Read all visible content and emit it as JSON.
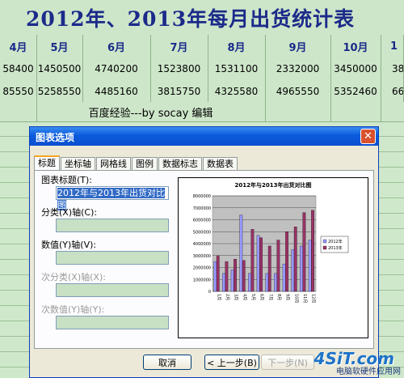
{
  "sheet": {
    "title": "2012年、2013年每月出货统计表",
    "months": [
      "4月",
      "5月",
      "6月",
      "7月",
      "8月",
      "9月",
      "10月",
      "1"
    ],
    "row_2012": [
      "58400",
      "1450500",
      "4740200",
      "1523800",
      "1531100",
      "2332000",
      "3450000",
      "38"
    ],
    "row_2013": [
      "85550",
      "5258550",
      "4485160",
      "3815750",
      "4325580",
      "4965550",
      "5352460",
      "66"
    ],
    "note": "百度经验---by socay 编辑"
  },
  "dialog": {
    "title": "图表选项",
    "close_label": "✕",
    "tabs": [
      "标题",
      "坐标轴",
      "网格线",
      "图例",
      "数据标志",
      "数据表"
    ],
    "active_tab": "标题",
    "fields": {
      "chart_title_label": "图表标题(T):",
      "chart_title_value": "2012年与2013年出货对比图",
      "category_x_label": "分类(X)轴(C):",
      "value_y_label": "数值(Y)轴(V):",
      "secondary_category_label": "次分类(X)轴(X):",
      "secondary_value_label": "次数值(Y)轴(Y):"
    },
    "buttons": {
      "cancel": "取消",
      "back": "< 上一步(B)",
      "next": "下一步(N)"
    }
  },
  "chart_data": {
    "type": "bar",
    "title": "2012年与2013年出货对比图",
    "categories": [
      "1月",
      "2月",
      "3月",
      "4月",
      "5月",
      "6月",
      "7月",
      "8月",
      "9月",
      "10月",
      "11月",
      "12月"
    ],
    "ylim": [
      0,
      8000000
    ],
    "yticks": [
      "8000000",
      "7000000",
      "6000000",
      "5000000",
      "4000000",
      "3000000",
      "2000000",
      "1000000",
      "0"
    ],
    "legend_position": "right",
    "series": [
      {
        "name": "2012年",
        "color": "#9999ff",
        "values": [
          2500000,
          1500000,
          1800000,
          6400000,
          1500000,
          4700000,
          1500000,
          1500000,
          2300000,
          3500000,
          3800000,
          4300000
        ]
      },
      {
        "name": "2013年",
        "color": "#993366",
        "values": [
          3000000,
          2500000,
          2700000,
          2600000,
          5200000,
          4500000,
          3800000,
          4300000,
          5000000,
          5400000,
          6600000,
          6800000
        ]
      }
    ]
  },
  "watermark": {
    "logo": "4SiT.com",
    "text": "电脑软硬件应用网"
  }
}
